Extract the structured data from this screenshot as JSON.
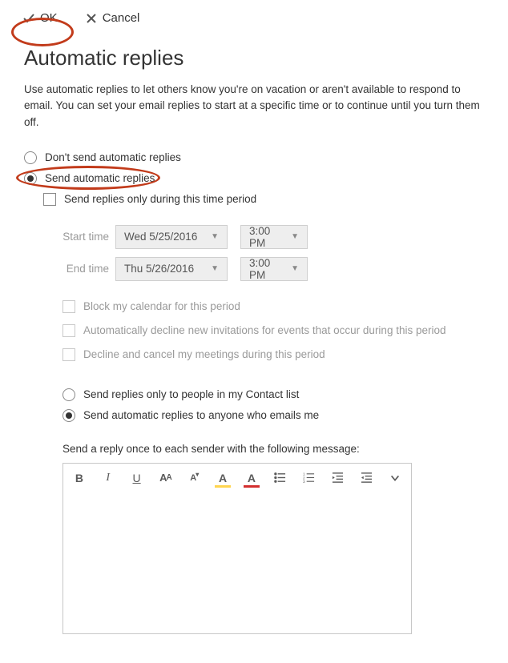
{
  "toolbar": {
    "ok_label": "OK",
    "cancel_label": "Cancel"
  },
  "page": {
    "title": "Automatic replies",
    "description": "Use automatic replies to let others know you're on vacation or aren't available to respond to email. You can set your email replies to start at a specific time or to continue until you turn them off."
  },
  "options": {
    "dont_send": "Don't send automatic replies",
    "send": "Send automatic replies",
    "only_during_period": "Send replies only during this time period",
    "start_label": "Start time",
    "end_label": "End time",
    "start_date": "Wed 5/25/2016",
    "start_time": "3:00 PM",
    "end_date": "Thu 5/26/2016",
    "end_time": "3:00 PM",
    "block_calendar": "Block my calendar for this period",
    "auto_decline": "Automatically decline new invitations for events that occur during this period",
    "decline_cancel": "Decline and cancel my meetings during this period",
    "replies_contacts_only": "Send replies only to people in my Contact list",
    "replies_anyone": "Send automatic replies to anyone who emails me",
    "reply_message_label": "Send a reply once to each sender with the following message:"
  }
}
